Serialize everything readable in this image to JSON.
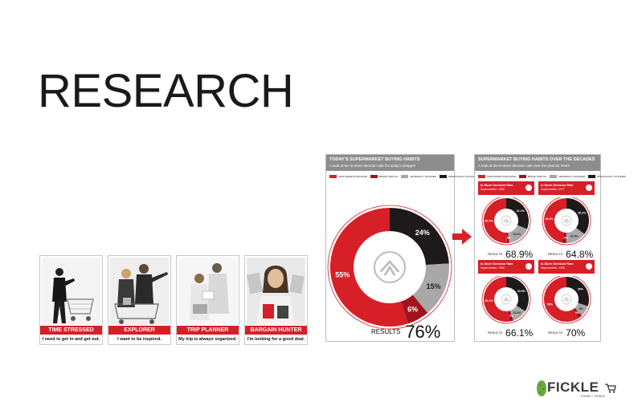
{
  "page": {
    "title": "RESEARCH"
  },
  "personas": [
    {
      "label": "TIME STRESSED",
      "quote": "I need to get in and get out."
    },
    {
      "label": "EXPLORER",
      "quote": "I want to be inspired."
    },
    {
      "label": "TRIP PLANNER",
      "quote": "My trip is always organized."
    },
    {
      "label": "BARGAIN HUNTER",
      "quote": "I'm looking for a good deal."
    }
  ],
  "panel_today": {
    "title": "TODAY'S SUPERMARKET BUYING HABITS",
    "subtitle": "A look at the in-store decision rate for today's shopper",
    "legend": [
      "UNPLANNED PURCHASE",
      "BRAND SWITCH",
      "GENERALLY PLANNED",
      "SPECIFICALLY PLANNED"
    ],
    "results_label": "RESULTS",
    "results_value": "76%"
  },
  "panel_decades": {
    "title": "SUPERMARKET BUYING HABITS OVER THE DECADES",
    "subtitle": "A look at the in-store decision rate over the past 50 Years",
    "legend": [
      "UNPLANNED PURCHASE",
      "BRAND SWITCH",
      "GENERALLY PLANNED",
      "SPECIFICALLY PLANNED"
    ],
    "minis": [
      {
        "title": "In-Store Decision Rate",
        "subtitle": "Supermarkets • 1965",
        "results_label": "RESULTS",
        "results_value": "68.9%"
      },
      {
        "title": "In-Store Decision Rate",
        "subtitle": "Supermarkets • 1977",
        "results_label": "RESULTS",
        "results_value": "64.8%"
      },
      {
        "title": "In-Store Decision Rate",
        "subtitle": "Supermarkets • 1986",
        "results_label": "RESULTS",
        "results_value": "66.1%"
      },
      {
        "title": "In-Store Decision Rate",
        "subtitle": "Supermarkets • 1995",
        "results_label": "RESULTS",
        "results_value": "70%"
      }
    ]
  },
  "colors": {
    "red": "#d71f27",
    "dark_red": "#a0141b",
    "gray": "#a8a8a8",
    "black": "#1e1a1b"
  },
  "chart_data": [
    {
      "type": "pie",
      "categories": [
        "UNPLANNED PURCHASE",
        "BRAND SWITCH",
        "GENERALLY PLANNED",
        "SPECIFICALLY PLANNED"
      ],
      "values": [
        55,
        6,
        15,
        24
      ],
      "labels": [
        "55%",
        "6%",
        "15%",
        "24%"
      ],
      "title": "TODAY'S SUPERMARKET BUYING HABITS"
    },
    {
      "type": "pie",
      "categories": [
        "UNPLANNED PURCHASE",
        "BRAND SWITCH",
        "GENERALLY PLANNED",
        "SPECIFICALLY PLANNED"
      ],
      "values": [
        50.5,
        1.8,
        16.6,
        31.1
      ],
      "labels": [
        "50.5%",
        "1.8%",
        "16.6%",
        "31.1%"
      ]
    },
    {
      "type": "pie",
      "categories": [
        "UNPLANNED PURCHASE",
        "BRAND SWITCH",
        "GENERALLY PLANNED",
        "SPECIFICALLY PLANNED"
      ],
      "values": [
        46.6,
        3.2,
        14.9,
        35.2
      ],
      "labels": [
        "46.6%",
        "3.2%",
        "14.9%",
        "35.2%"
      ]
    },
    {
      "type": "pie",
      "categories": [
        "UNPLANNED PURCHASE",
        "BRAND SWITCH",
        "GENERALLY PLANNED",
        "SPECIFICALLY PLANNED"
      ],
      "values": [
        52.4,
        2.7,
        11.0,
        33.9
      ],
      "labels": [
        "52.4%",
        "2.7%",
        "11.0%",
        "33.9%"
      ]
    },
    {
      "type": "pie",
      "categories": [
        "UNPLANNED PURCHASE",
        "BRAND SWITCH",
        "GENERALLY PLANNED",
        "SPECIFICALLY PLANNED"
      ],
      "values": [
        59,
        3,
        8,
        30
      ],
      "labels": [
        "59%",
        "3%",
        "8%",
        "30%"
      ]
    }
  ],
  "logo": {
    "word": "FICKLE",
    "tagline": "FOOD + TICKLE"
  }
}
